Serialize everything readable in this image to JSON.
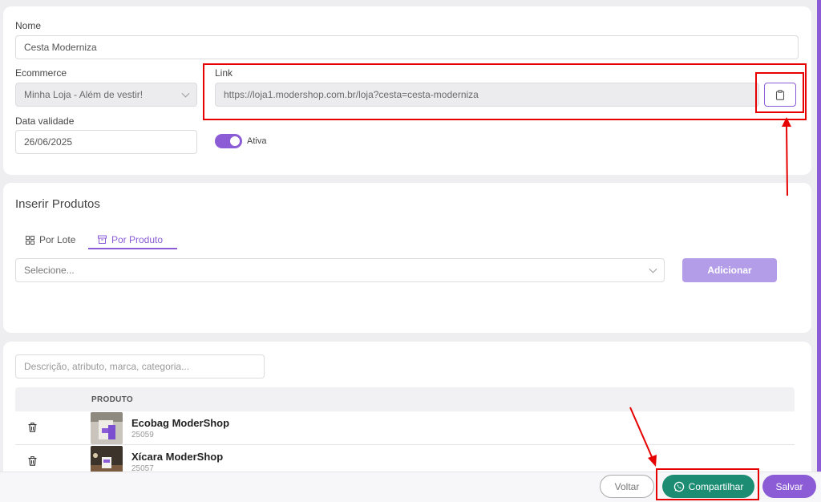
{
  "form": {
    "nome_label": "Nome",
    "nome_value": "Cesta Moderniza",
    "ecommerce_label": "Ecommerce",
    "ecommerce_value": "Minha Loja - Além de vestir!",
    "link_label": "Link",
    "link_value": "https://loja1.modershop.com.br/loja?cesta=cesta-moderniza",
    "validade_label": "Data validade",
    "validade_value": "26/06/2025",
    "ativa_label": "Ativa",
    "ativa_on": true
  },
  "produtos": {
    "title": "Inserir Produtos",
    "tabs": [
      {
        "label": "Por Lote",
        "icon": "grid-icon",
        "active": false
      },
      {
        "label": "Por Produto",
        "icon": "box-icon",
        "active": true
      }
    ],
    "select_placeholder": "Selecione...",
    "add_label": "Adicionar"
  },
  "table": {
    "search_placeholder": "Descrição, atributo, marca, categoria...",
    "header_produto": "PRODUTO",
    "rows": [
      {
        "name": "Ecobag ModerShop",
        "id": "25059"
      },
      {
        "name": "Xícara ModerShop",
        "id": "25057"
      }
    ]
  },
  "footer": {
    "voltar": "Voltar",
    "compartilhar": "Compartilhar",
    "salvar": "Salvar"
  },
  "colors": {
    "accent": "#8b5cd6",
    "whatsapp": "#1c8c73",
    "annotation": "#e60000"
  }
}
